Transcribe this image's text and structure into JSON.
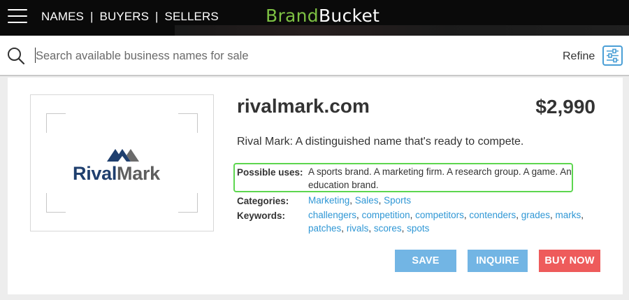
{
  "header": {
    "nav": [
      "NAMES",
      "BUYERS",
      "SELLERS"
    ],
    "separator": "|",
    "brand_part1": "Brand",
    "brand_part2": "Bucket",
    "colors": {
      "background": "#0a0a0a",
      "brand_green": "#7dc043",
      "text": "#ffffff"
    },
    "icons": {
      "menu": "hamburger-menu-icon"
    }
  },
  "search": {
    "placeholder": "Search available business names for sale",
    "value": "",
    "refine_label": "Refine",
    "icons": {
      "search": "search-icon",
      "refine": "sliders-icon"
    }
  },
  "listing": {
    "logo": {
      "word1": "Rival",
      "word2": "Mark",
      "mark_icon": "mountain-peaks-icon"
    },
    "domain": "rivalmark.com",
    "price": "$2,990",
    "tagline": "Rival Mark: A distinguished name that's ready to compete.",
    "possible_uses_label": "Possible uses:",
    "possible_uses": "A sports brand. A marketing firm. A research group. A game. An education brand.",
    "categories_label": "Categories:",
    "categories": [
      "Marketing",
      "Sales",
      "Sports"
    ],
    "keywords_label": "Keywords:",
    "keywords": [
      "challengers",
      "competition",
      "competitors",
      "contenders",
      "grades",
      "marks",
      "patches",
      "rivals",
      "scores",
      "spots"
    ],
    "link_color": "#2f97d5",
    "highlight_color": "#5dd64f"
  },
  "actions": {
    "save": "SAVE",
    "inquire": "INQUIRE",
    "buy_now": "BUY NOW",
    "colors": {
      "primary": "#72b5e4",
      "buy": "#ee5b5b"
    }
  }
}
